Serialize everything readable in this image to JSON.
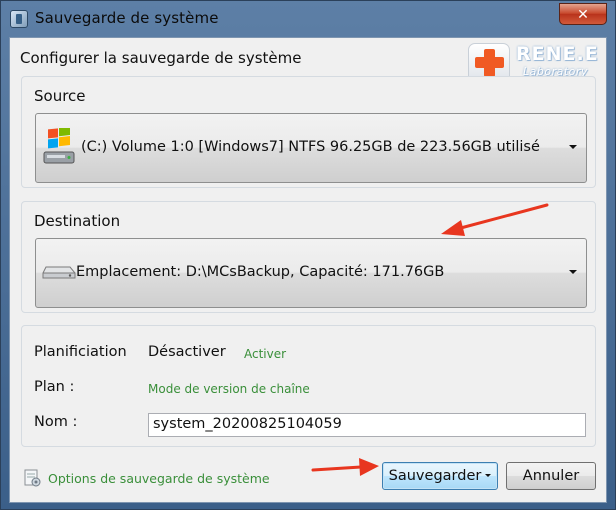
{
  "window": {
    "title": "Sauvegarde de système",
    "close_glyph": "✕"
  },
  "header": {
    "title": "Configurer la sauvegarde de système",
    "logo_text": "RENE.E",
    "logo_sub": "Laboratory"
  },
  "source": {
    "label": "Source",
    "value": "(C:) Volume 1:0 [Windows7] NTFS   96.25GB de 223.56GB utilisé",
    "icon": "windows-drive-icon"
  },
  "destination": {
    "label": "Destination",
    "value": "Emplacement: D:\\MCsBackup, Capacité: 171.76GB",
    "icon": "disk-drive-icon"
  },
  "schedule": {
    "planification_label": "Planificiation",
    "planification_value": "Désactiver",
    "activate_link": "Activer",
    "plan_label": "Plan :",
    "plan_value": "Mode de version de chaîne",
    "name_label": "Nom :",
    "name_value": "system_20200825104059"
  },
  "footer": {
    "options_link": "Options de sauvegarde de système",
    "save_button": "Sauvegarder",
    "cancel_button": "Annuler"
  },
  "colors": {
    "accent_green": "#3a8f3a",
    "annotation_red": "#e8361f",
    "logo_orange": "#f05a24"
  }
}
